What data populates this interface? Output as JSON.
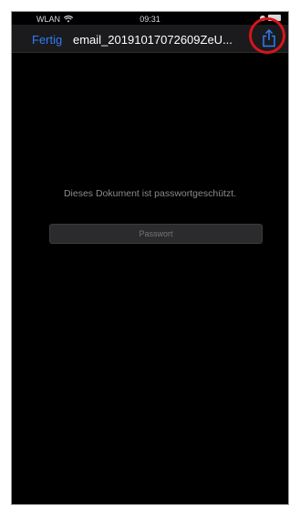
{
  "status_bar": {
    "carrier": "WLAN",
    "time": "09:31"
  },
  "nav": {
    "done_label": "Fertig",
    "title": "email_20191017072609ZeU..."
  },
  "document": {
    "protected_message": "Dieses Dokument ist passwortgeschützt.",
    "password_placeholder": "Passwort"
  },
  "colors": {
    "accent": "#2f7cf6",
    "highlight": "#d8141b",
    "background": "#000000"
  },
  "icons": {
    "share": "share-icon",
    "wifi": "wifi-icon",
    "battery": "battery-icon"
  }
}
